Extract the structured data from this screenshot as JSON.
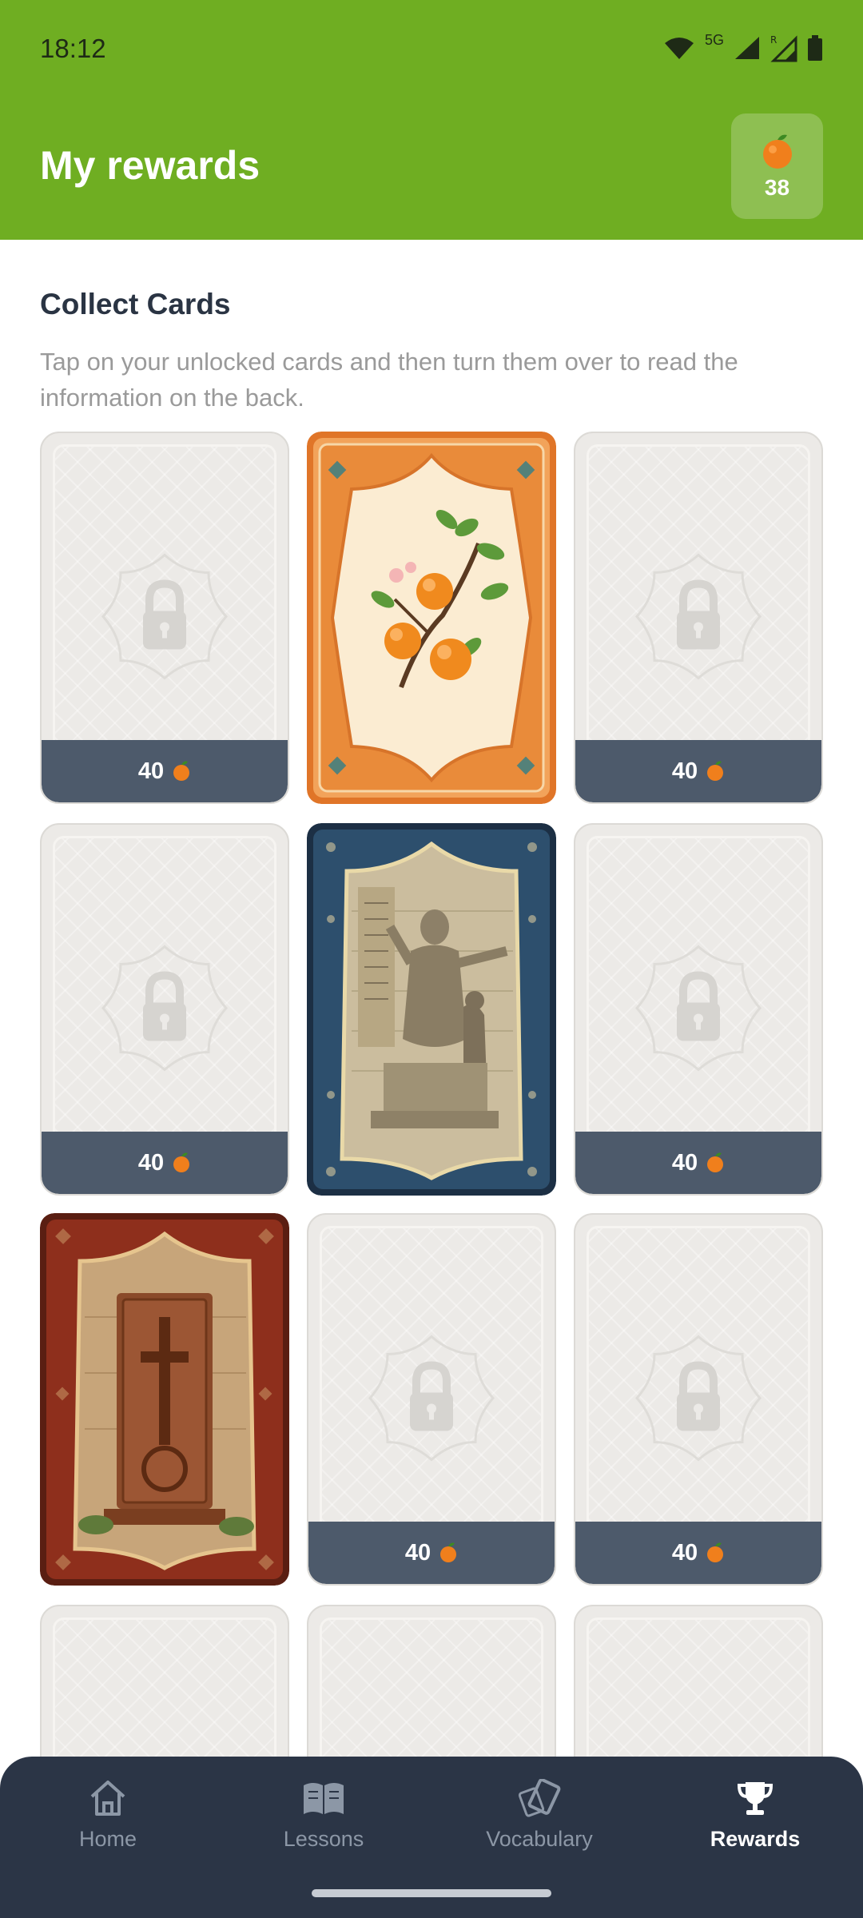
{
  "status_bar": {
    "time": "18:12",
    "network": "5G"
  },
  "header": {
    "title": "My rewards",
    "coins": "38"
  },
  "section": {
    "title": "Collect Cards",
    "description": "Tap on your unlocked cards and then turn them over to read the information on the back."
  },
  "cards": [
    {
      "state": "locked",
      "price": "40"
    },
    {
      "state": "unlocked",
      "subject": "apricot-branch"
    },
    {
      "state": "locked",
      "price": "40"
    },
    {
      "state": "locked",
      "price": "40"
    },
    {
      "state": "unlocked",
      "subject": "statue-with-alphabet"
    },
    {
      "state": "locked",
      "price": "40"
    },
    {
      "state": "unlocked",
      "subject": "khachkar-cross-stone"
    },
    {
      "state": "locked",
      "price": "40"
    },
    {
      "state": "locked",
      "price": "40"
    },
    {
      "state": "locked"
    },
    {
      "state": "locked"
    },
    {
      "state": "locked"
    }
  ],
  "nav": {
    "home": "Home",
    "lessons": "Lessons",
    "vocabulary": "Vocabulary",
    "rewards": "Rewards",
    "active": "rewards"
  },
  "colors": {
    "header_green": "#6fae22",
    "price_bar": "#4d5a6b",
    "nav_background": "#2b3546",
    "apricot_orange": "#f07f1c"
  }
}
